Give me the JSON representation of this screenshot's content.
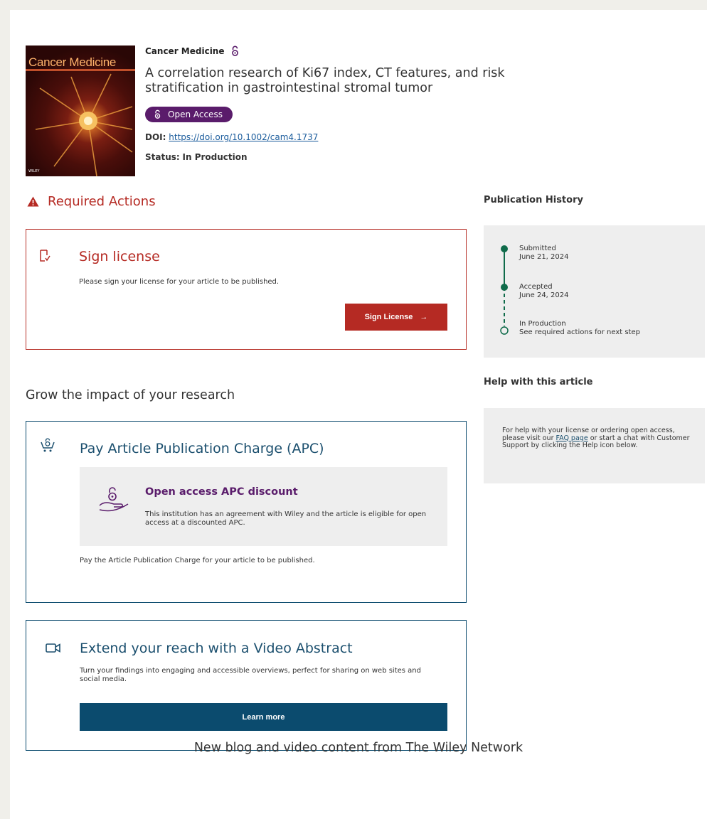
{
  "article": {
    "journal": "Cancer Medicine",
    "title": "A correlation research of Ki67 index, CT features, and risk stratification in gastrointestinal stromal tumor",
    "badge": "Open Access",
    "doi_label": "DOI:",
    "doi_url": "https://doi.org/10.1002/cam4.1737",
    "status_label": "Status:",
    "status_value": "In Production",
    "cover": {
      "journal_name": "Cancer Medicine",
      "publisher": "WILEY"
    }
  },
  "required_actions": {
    "title": "Required Actions",
    "sign": {
      "heading": "Sign license",
      "text": "Please sign your license for your article to be published.",
      "button": "Sign License"
    }
  },
  "grow": {
    "title": "Grow the impact of your research",
    "apc": {
      "heading": "Pay Article Publication Charge (APC)",
      "discount_title": "Open access APC discount",
      "discount_text": "This institution has an agreement with Wiley and the article is eligible for open access at a discounted APC.",
      "text": "Pay the Article Publication Charge for your article to be published."
    },
    "video": {
      "heading": "Extend your reach with a Video Abstract",
      "text": "Turn your findings into engaging and accessible overviews, perfect for sharing on web sites and social media.",
      "button": "Learn more"
    }
  },
  "history": {
    "title": "Publication History",
    "steps": [
      {
        "label": "Submitted",
        "detail": "June 21, 2024"
      },
      {
        "label": "Accepted",
        "detail": "June 24, 2024"
      },
      {
        "label": "In Production",
        "detail": "See required actions for next step"
      }
    ]
  },
  "help": {
    "title": "Help with this article",
    "text_before": "For help with your license or ordering open access, please visit our ",
    "link": "FAQ page",
    "text_after": " or start a chat with Customer Support by clicking the Help icon below."
  },
  "footer": {
    "title": "New blog and video content from The Wiley Network"
  },
  "colors": {
    "accent_red": "#b52a23",
    "accent_blue": "#0b4b6e",
    "open_access_purple": "#5a1c6b",
    "timeline_green": "#0f6b4a"
  }
}
